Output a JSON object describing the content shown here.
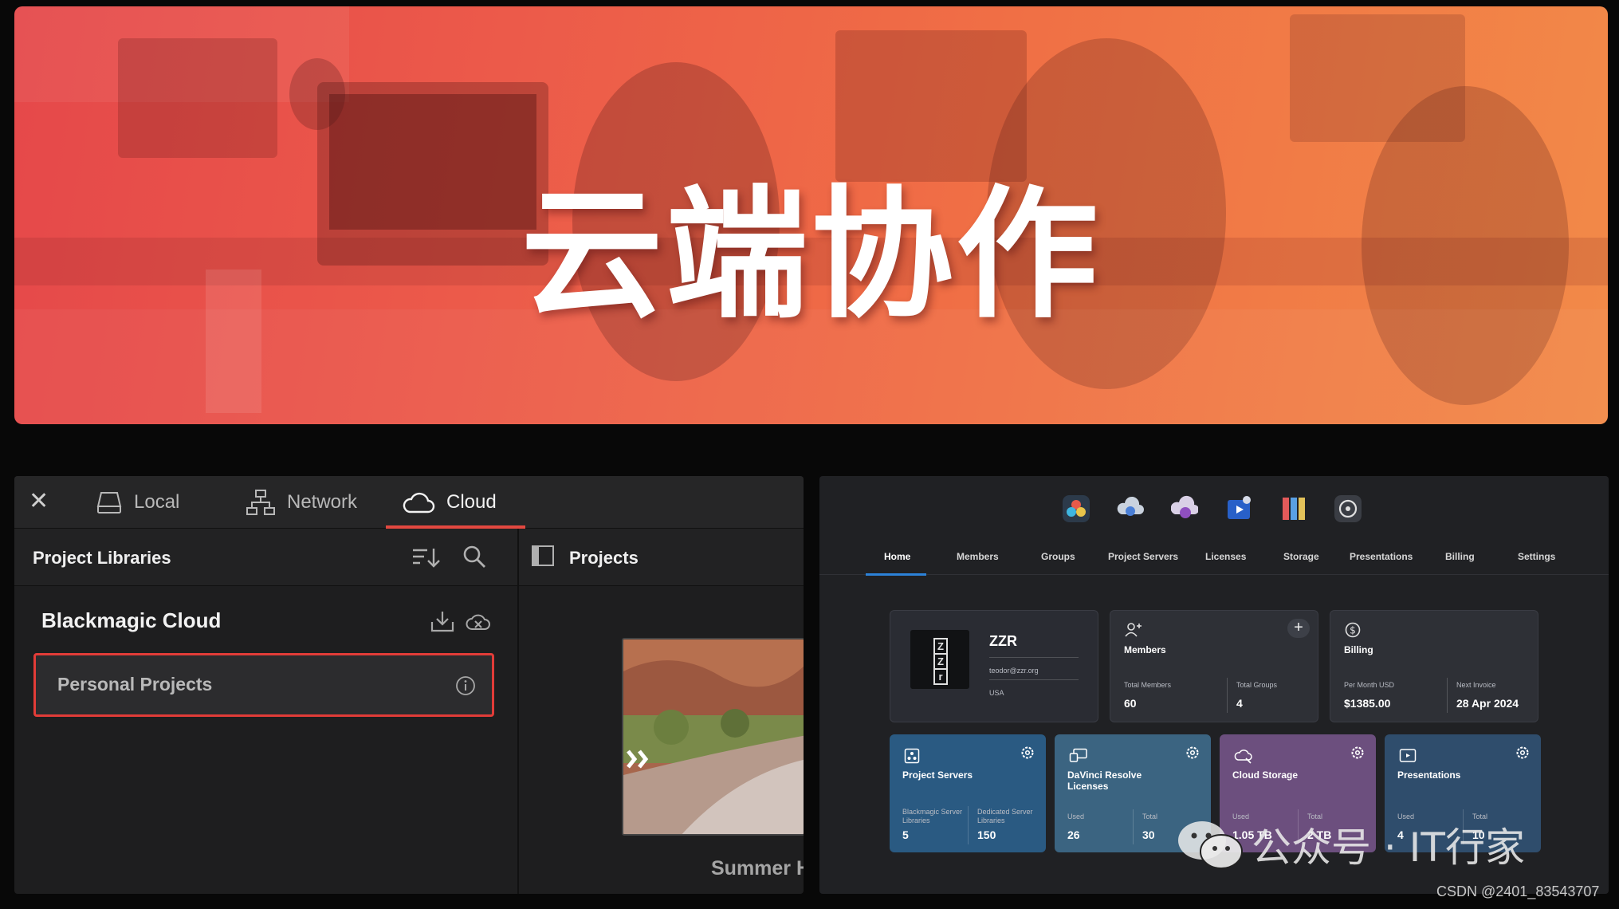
{
  "banner": {
    "title": "云端协作"
  },
  "left_panel": {
    "tabs": {
      "local": "Local",
      "network": "Network",
      "cloud": "Cloud"
    },
    "project_libraries_label": "Project Libraries",
    "projects_label": "Projects",
    "library_name": "Blackmagic Cloud",
    "personal_projects": "Personal Projects",
    "project_thumb_title": "Summer H"
  },
  "right_panel": {
    "nav": [
      "Home",
      "Members",
      "Groups",
      "Project Servers",
      "Licenses",
      "Storage",
      "Presentations",
      "Billing",
      "Settings"
    ],
    "org": {
      "name": "ZZR",
      "email": "teodor@zzr.org",
      "country": "USA",
      "logo_letters": [
        "Z",
        "Z",
        "r"
      ]
    },
    "members": {
      "title": "Members",
      "total_members_label": "Total Members",
      "total_members": "60",
      "total_groups_label": "Total Groups",
      "total_groups": "4"
    },
    "billing": {
      "title": "Billing",
      "per_month_label": "Per Month USD",
      "per_month": "$1385.00",
      "next_invoice_label": "Next Invoice",
      "next_invoice": "28 Apr 2024"
    },
    "project_servers": {
      "title": "Project Servers",
      "label1": "Blackmagic Server Libraries",
      "value1": "5",
      "label2": "Dedicated Server Libraries",
      "value2": "150"
    },
    "licenses": {
      "title": "DaVinci Resolve Licenses",
      "used_label": "Used",
      "used": "26",
      "total_label": "Total",
      "total": "30"
    },
    "cloud_storage": {
      "title": "Cloud Storage",
      "used_label": "Used",
      "used": "1.05 TB",
      "total_label": "Total",
      "total": "2 TB"
    },
    "presentations": {
      "title": "Presentations",
      "used_label": "Used",
      "used": "4",
      "total_label": "Total",
      "total": "10"
    }
  },
  "watermark": {
    "text": "公众号 · IT行家"
  },
  "credit": "CSDN @2401_83543707",
  "colors": {
    "accent_red": "#e23c38",
    "nav_blue": "#2c82d8",
    "servers_card": "#2a5a82",
    "licenses_card": "#3b6481",
    "storage_card": "#6c4f7e",
    "presentations_card": "#2f4d6c"
  }
}
